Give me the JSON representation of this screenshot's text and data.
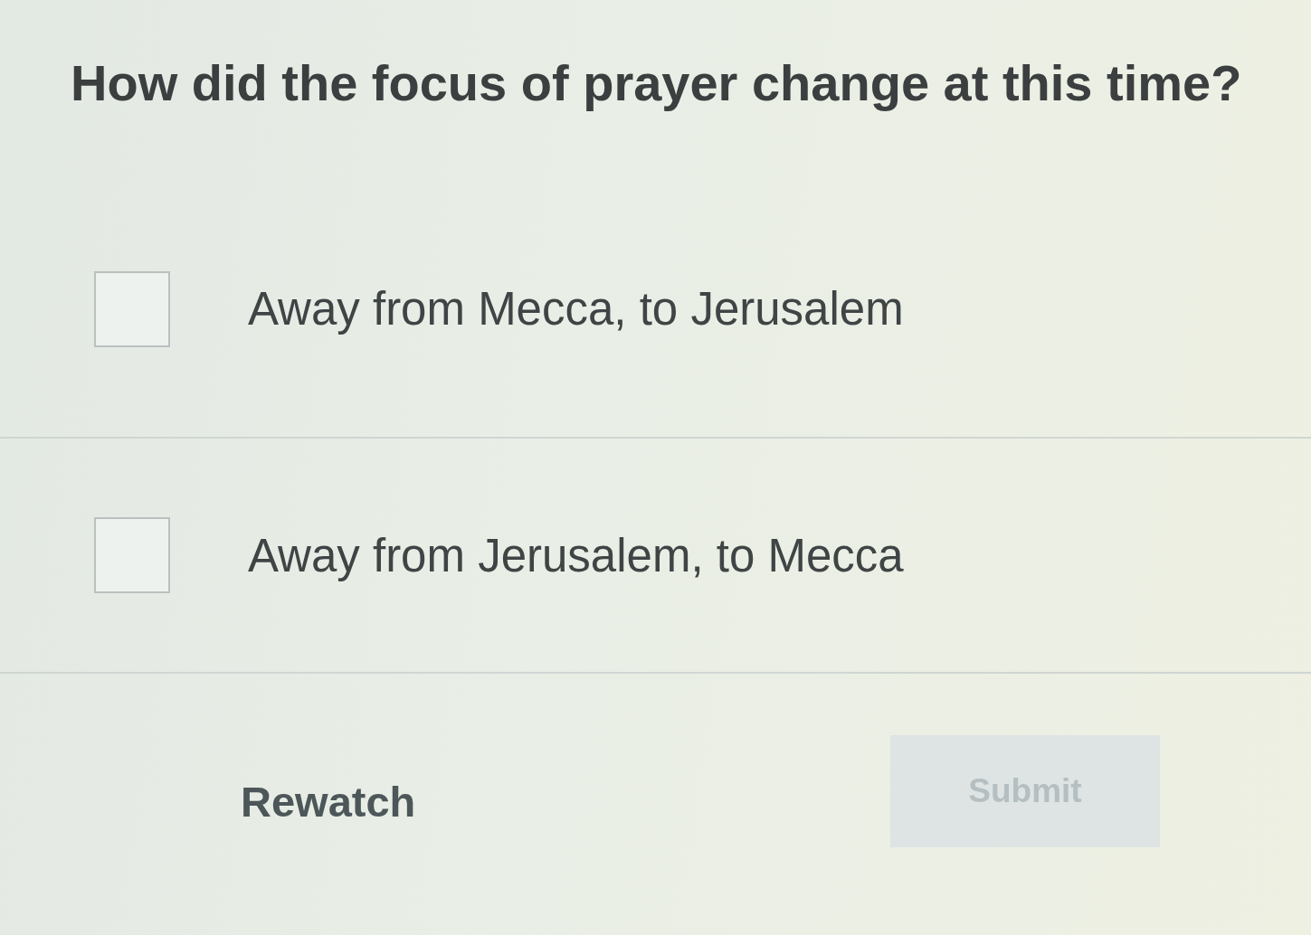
{
  "question": "How did the focus of prayer change at this time?",
  "options": [
    {
      "label": "Away from Mecca, to Jerusalem",
      "checked": false
    },
    {
      "label": "Away from Jerusalem, to Mecca",
      "checked": false
    }
  ],
  "actions": {
    "rewatch": {
      "label": "Rewatch"
    },
    "submit": {
      "label": "Submit",
      "disabled": true
    }
  }
}
